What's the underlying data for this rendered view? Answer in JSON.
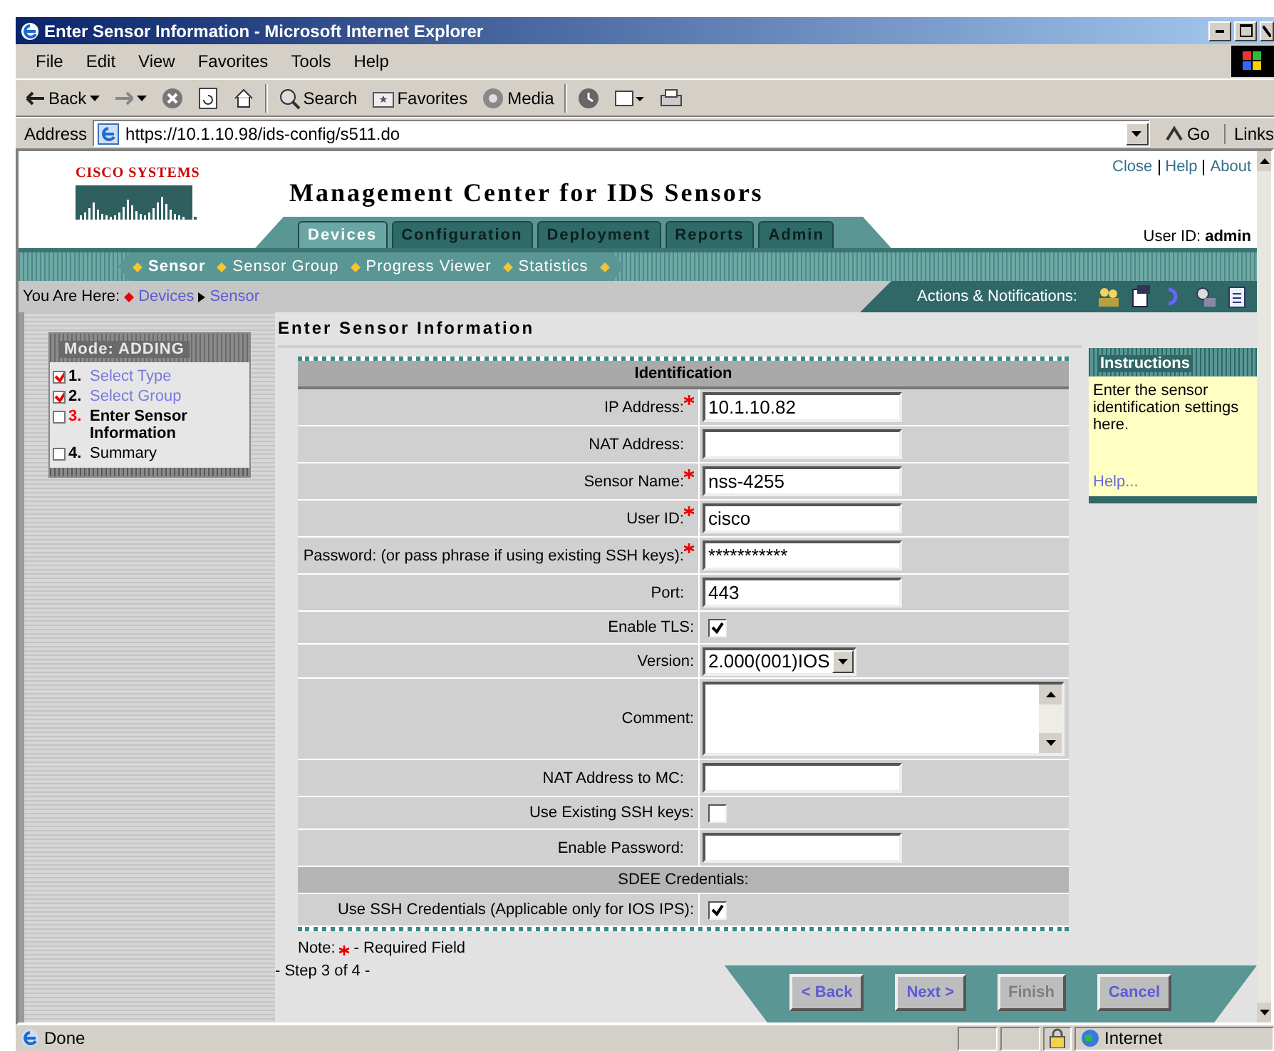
{
  "window": {
    "title": "Enter Sensor Information - Microsoft Internet Explorer"
  },
  "menu": [
    "File",
    "Edit",
    "View",
    "Favorites",
    "Tools",
    "Help"
  ],
  "toolbar": [
    {
      "kind": "back",
      "label": "Back"
    },
    {
      "kind": "forward"
    },
    {
      "kind": "stop"
    },
    {
      "kind": "refresh"
    },
    {
      "kind": "home"
    },
    {
      "kind": "search",
      "label": "Search"
    },
    {
      "kind": "favorites",
      "label": "Favorites"
    },
    {
      "kind": "media",
      "label": "Media"
    },
    {
      "kind": "history"
    },
    {
      "kind": "mail"
    },
    {
      "kind": "print"
    }
  ],
  "address": {
    "label": "Address",
    "url": "https://10.1.10.98/ids-config/s511.do",
    "go": "Go",
    "links": "Links"
  },
  "header": {
    "logo": "CISCO SYSTEMS",
    "title": "Management Center for IDS Sensors",
    "top_links": [
      "Close",
      "Help",
      "About"
    ],
    "user_label": "User ID:",
    "user": "admin"
  },
  "tabs": [
    {
      "label": "Devices",
      "selected": true
    },
    {
      "label": "Configuration",
      "selected": false
    },
    {
      "label": "Deployment",
      "selected": false
    },
    {
      "label": "Reports",
      "selected": false
    },
    {
      "label": "Admin",
      "selected": false
    }
  ],
  "subnav": [
    {
      "label": "Sensor",
      "selected": true
    },
    {
      "label": "Sensor Group",
      "selected": false
    },
    {
      "label": "Progress Viewer",
      "selected": false
    },
    {
      "label": "Statistics",
      "selected": false
    }
  ],
  "breadcrumb": {
    "label": "You Are Here:",
    "items": [
      "Devices",
      "Sensor"
    ]
  },
  "actions": {
    "label": "Actions & Notifications:"
  },
  "wizard": {
    "mode": "Mode: ADDING",
    "steps": [
      {
        "number": "1.",
        "label": "Select Type",
        "checked": true,
        "selected": false
      },
      {
        "number": "2.",
        "label": "Select Group",
        "checked": true,
        "selected": false
      },
      {
        "number": "3.",
        "label": "Enter Sensor Information",
        "checked": false,
        "selected": true
      },
      {
        "number": "4.",
        "label": "Summary",
        "checked": false,
        "selected": false
      }
    ]
  },
  "page_heading": "Enter Sensor Information",
  "form": {
    "title": "Identification",
    "rows": [
      {
        "kind": "text",
        "label": "IP Address:",
        "required": true,
        "value": "10.1.10.82"
      },
      {
        "kind": "text",
        "label": "NAT Address:",
        "required": false,
        "value": ""
      },
      {
        "kind": "text",
        "label": "Sensor Name:",
        "required": true,
        "value": "nss-4255"
      },
      {
        "kind": "text",
        "label": "User ID:",
        "required": true,
        "value": "cisco"
      },
      {
        "kind": "text",
        "label": "Password: (or pass phrase if using existing SSH keys):",
        "required": true,
        "value": "***********"
      },
      {
        "kind": "text",
        "label": "Port:",
        "required": false,
        "value": "443"
      },
      {
        "kind": "checkbox",
        "label": "Enable TLS:",
        "checked": true
      },
      {
        "kind": "select",
        "label": "Version:",
        "value": "2.000(001)IOS"
      },
      {
        "kind": "textarea",
        "label": "Comment:"
      },
      {
        "kind": "text",
        "label": "NAT Address to MC:",
        "required": false,
        "value": ""
      },
      {
        "kind": "checkbox",
        "label": "Use Existing SSH keys:",
        "checked": false
      },
      {
        "kind": "text",
        "label": "Enable Password:",
        "required": false,
        "value": ""
      },
      {
        "kind": "section",
        "label": "SDEE Credentials:"
      },
      {
        "kind": "checkbox",
        "label": "Use SSH Credentials (Applicable only for IOS IPS):",
        "checked": true
      }
    ]
  },
  "note": {
    "label": "Note:",
    "text": "- Required Field"
  },
  "step": "- Step 3 of 4 -",
  "buttons": [
    {
      "label": "< Back",
      "disabled": false
    },
    {
      "label": "Next >",
      "disabled": false
    },
    {
      "label": "Finish",
      "disabled": true
    },
    {
      "label": "Cancel",
      "disabled": false
    }
  ],
  "instructions": {
    "title": "Instructions",
    "text": "Enter the sensor identification settings here.",
    "link": "Help..."
  },
  "status": {
    "text": "Done",
    "zone": "Internet"
  }
}
